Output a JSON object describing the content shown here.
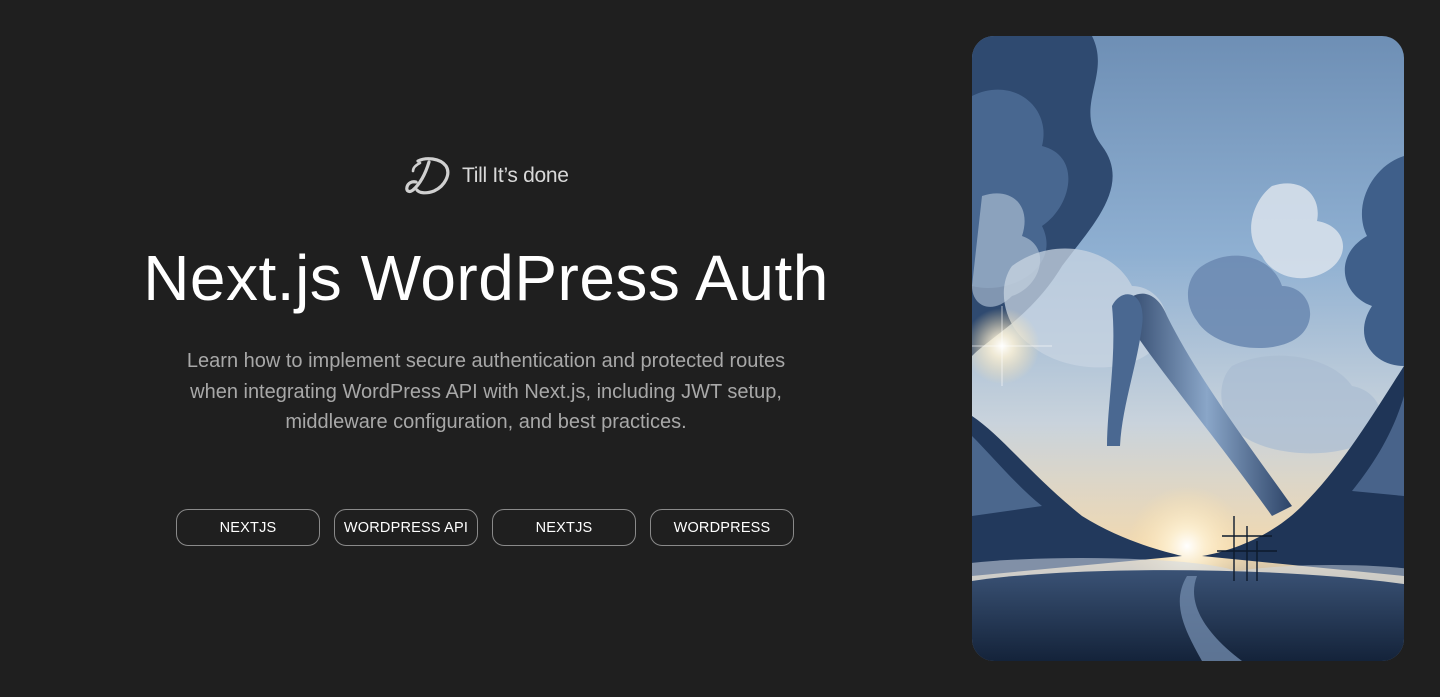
{
  "brand": {
    "name": "Till It’s done",
    "logo_icon": "brand-logo-icon"
  },
  "hero": {
    "title": "Next.js WordPress Auth",
    "description": "Learn how to implement secure authentication and protected routes when integrating WordPress API with Next.js, including JWT setup, middleware configuration, and best practices."
  },
  "tags": [
    {
      "label": "NEXTJS"
    },
    {
      "label": "WORDPRESS API"
    },
    {
      "label": "NEXTJS"
    },
    {
      "label": "WORDPRESS"
    }
  ],
  "image": {
    "subject": "surreal-cloud-landscape"
  },
  "colors": {
    "background": "#1f1f1f",
    "title": "#ffffff",
    "description": "#a8a8a8",
    "tag_border": "#8a8a8a"
  }
}
